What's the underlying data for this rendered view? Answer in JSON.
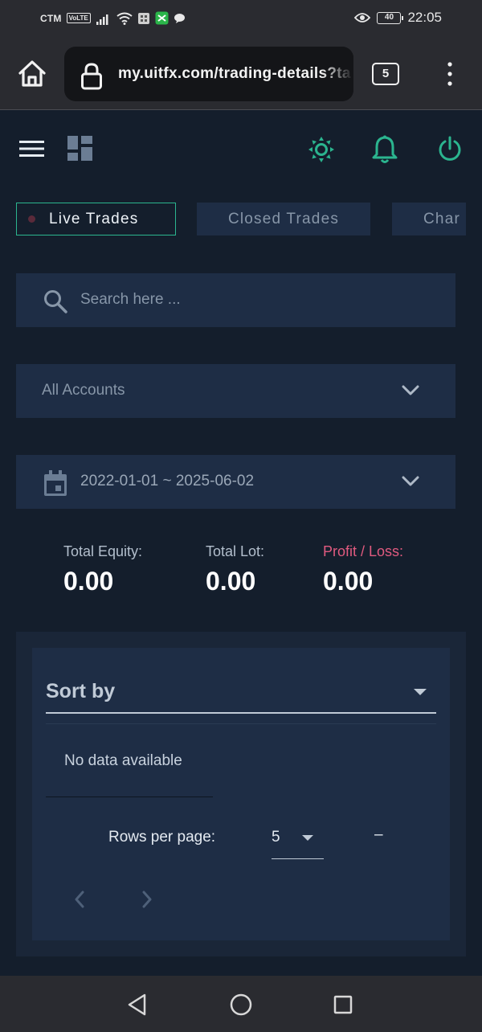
{
  "status_bar": {
    "carrier": "CTM",
    "volte": "VoLTE",
    "battery": "40",
    "time": "22:05"
  },
  "browser": {
    "url": "my.uitfx.com/trading-details?ta",
    "tab_count": "5"
  },
  "tabs": [
    {
      "label": "Live Trades",
      "active": true
    },
    {
      "label": "Closed Trades",
      "active": false
    },
    {
      "label": "Char",
      "active": false
    }
  ],
  "search": {
    "placeholder": "Search here ..."
  },
  "accounts": {
    "selected": "All Accounts"
  },
  "date_range": {
    "value": "2022-01-01 ~ 2025-06-02"
  },
  "stats": {
    "equity": {
      "label": "Total Equity:",
      "value": "0.00"
    },
    "lot": {
      "label": "Total Lot:",
      "value": "0.00"
    },
    "profit_loss": {
      "label": "Profit / Loss:",
      "value": "0.00"
    }
  },
  "table": {
    "sort_label": "Sort by",
    "empty_text": "No data available",
    "rows_per_page_label": "Rows per page:",
    "rows_per_page_value": "5",
    "page_range": "–"
  },
  "colors": {
    "background": "#141e2c",
    "panel": "#1e2d45",
    "accent": "#2bb58f",
    "loss": "#e05a7f"
  },
  "icons": [
    "home-icon",
    "lock-icon",
    "more-vert-icon",
    "menu-icon",
    "dashboard-icon",
    "theme-icon",
    "bell-icon",
    "power-icon",
    "search-icon",
    "calendar-icon",
    "chevron-down-icon",
    "chevron-left-icon",
    "chevron-right-icon"
  ]
}
